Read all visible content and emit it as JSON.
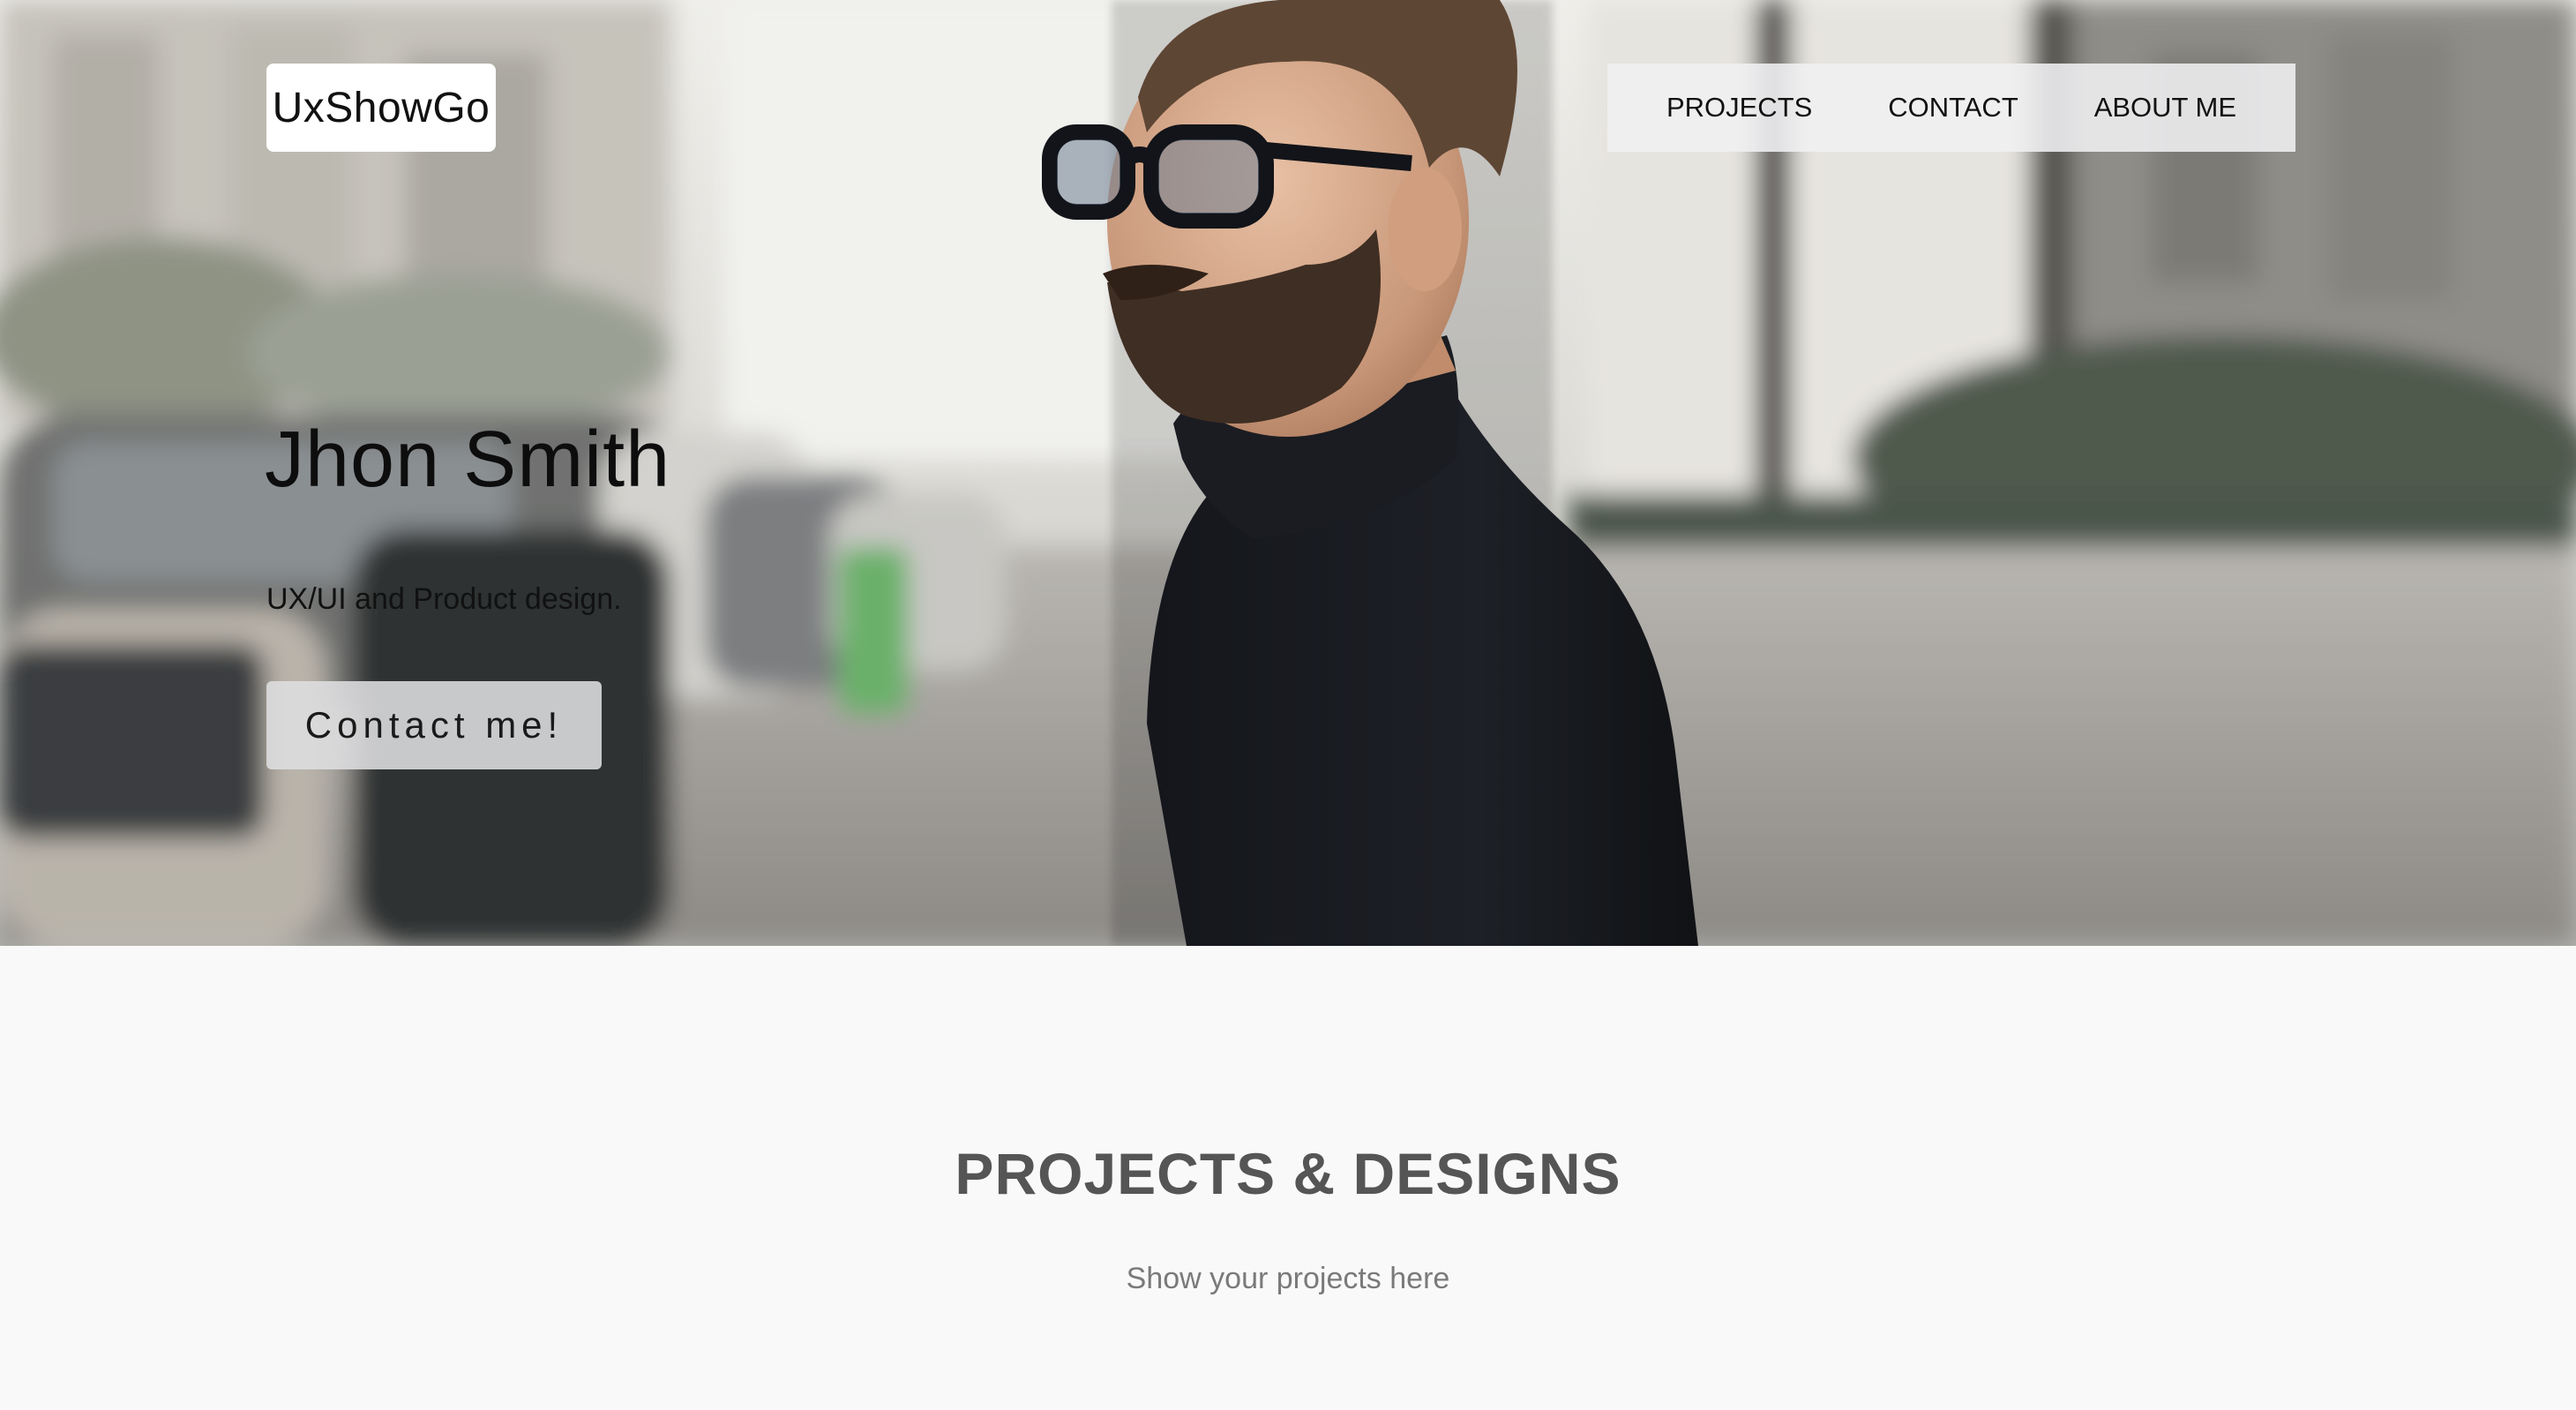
{
  "brand": {
    "logo_text": "UxShowGo"
  },
  "nav": {
    "items": [
      {
        "label": "PROJECTS"
      },
      {
        "label": "CONTACT"
      },
      {
        "label": "ABOUT ME"
      }
    ]
  },
  "hero": {
    "name": "Jhon Smith",
    "subtitle": "UX/UI and Product design.",
    "cta_label": "Contact me!"
  },
  "projects": {
    "title": "PROJECTS & DESIGNS",
    "subtitle": "Show your projects here"
  },
  "colors": {
    "section_title": "#555555",
    "section_sub": "#7a7a7a",
    "page_bg": "#f9f9f9"
  }
}
